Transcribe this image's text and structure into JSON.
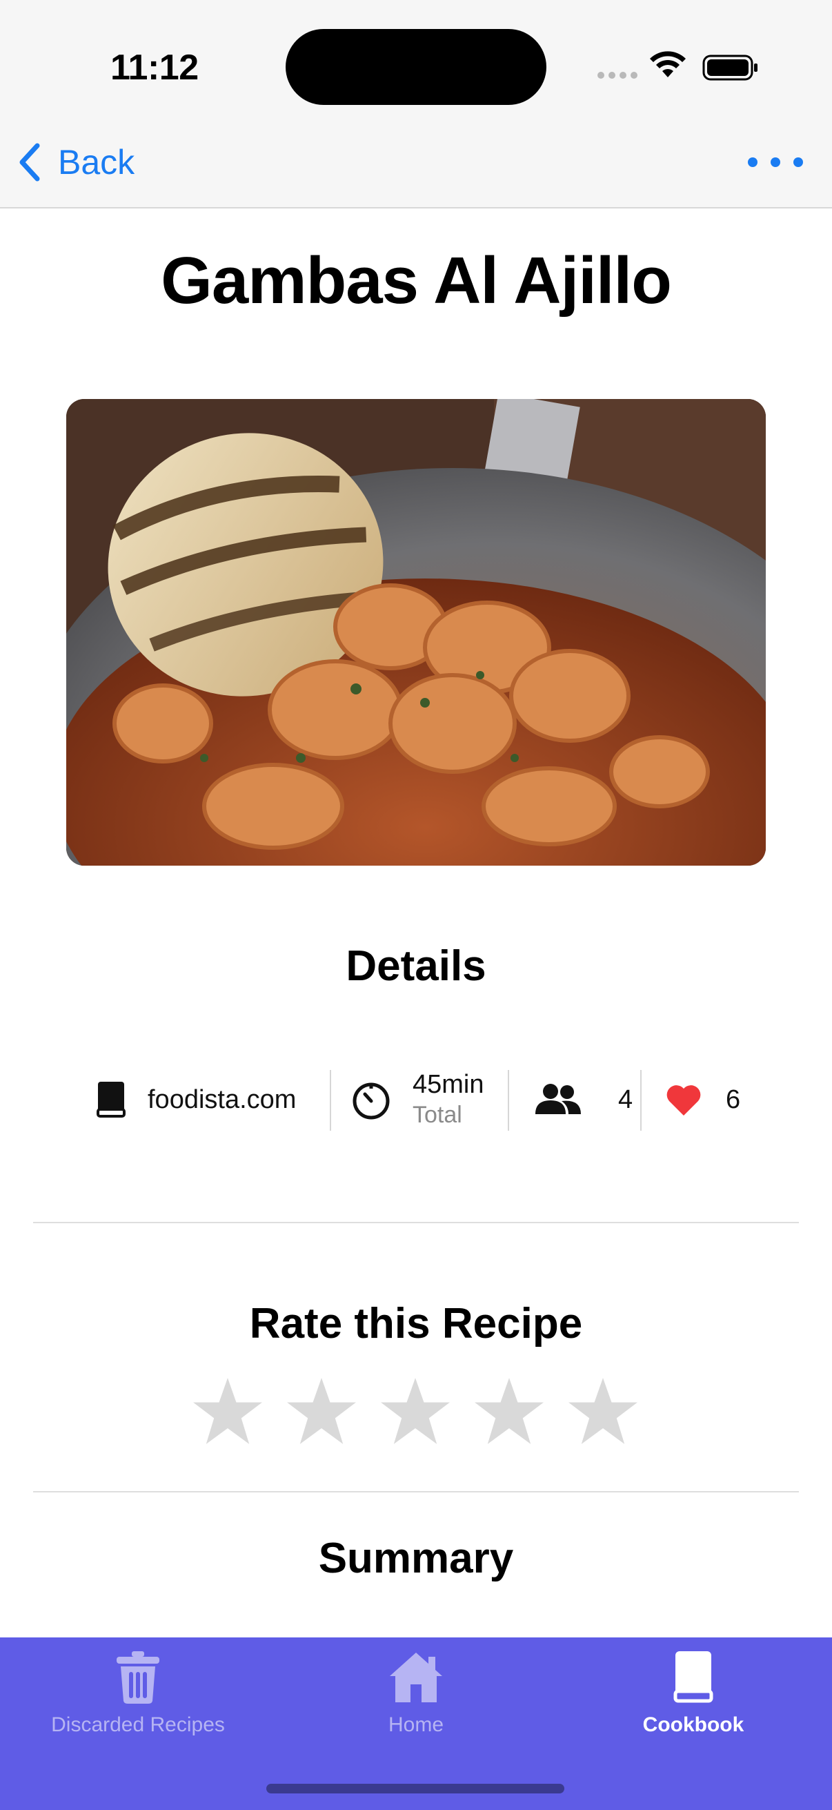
{
  "status_bar": {
    "time": "11:12"
  },
  "nav": {
    "back_label": "Back"
  },
  "recipe": {
    "title": "Gambas Al Ajillo",
    "image_alt": "Garlic shrimp in a pan with grilled bread"
  },
  "details": {
    "heading": "Details",
    "source": "foodista.com",
    "time_value": "45min",
    "time_label": "Total",
    "servings": "4",
    "likes": "6"
  },
  "rating": {
    "heading": "Rate this Recipe",
    "current": 0,
    "max": 5
  },
  "summary": {
    "heading": "Summary"
  },
  "tabs": [
    {
      "label": "Discarded Recipes",
      "icon": "trash-icon",
      "active": false
    },
    {
      "label": "Home",
      "icon": "house-icon",
      "active": false
    },
    {
      "label": "Cookbook",
      "icon": "book-icon",
      "active": true
    }
  ],
  "colors": {
    "accent": "#1a7cf2",
    "tabbar": "#5f5ce6",
    "heart": "#f0373b",
    "star_empty": "#d9d9d9"
  }
}
